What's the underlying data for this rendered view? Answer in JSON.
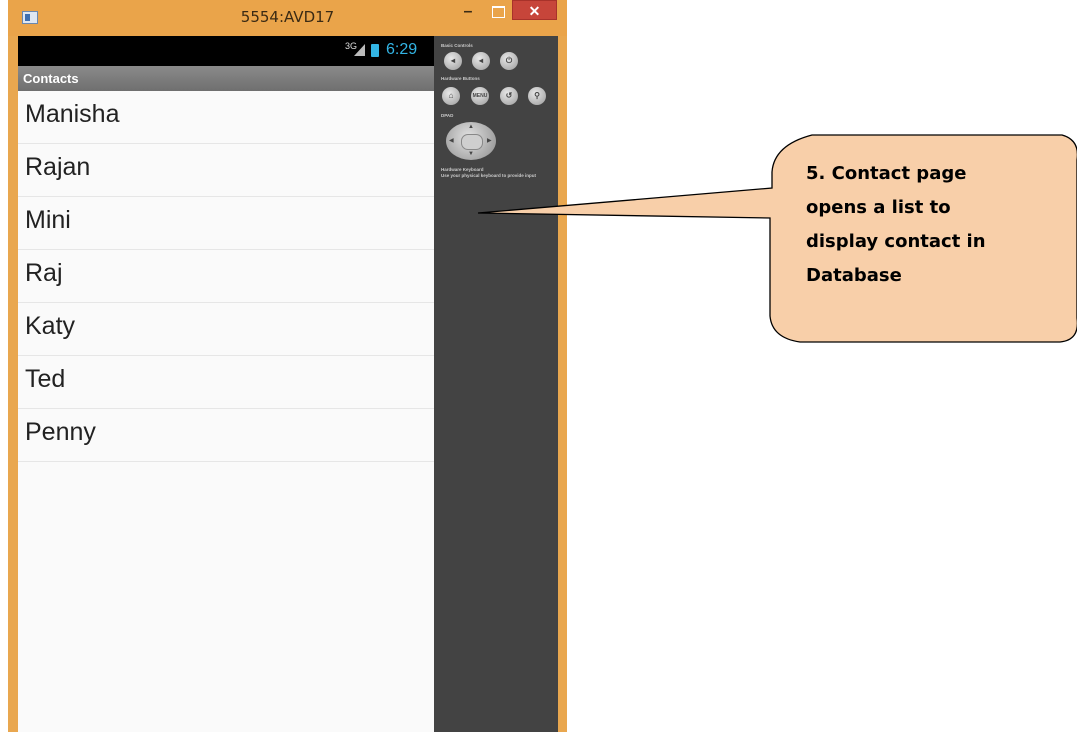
{
  "window": {
    "title": "5554:AVD17",
    "minimize_label": "–",
    "close_label": "✕"
  },
  "status_bar": {
    "network": "3G",
    "time": "6:29"
  },
  "action_bar": {
    "title": "Contacts"
  },
  "contacts": [
    "Manisha",
    "Rajan",
    "Mini",
    "Raj",
    "Katy",
    "Ted",
    "Penny"
  ],
  "controls": {
    "basic_controls_label": "Basic Controls",
    "hardware_buttons_label": "Hardware Buttons",
    "dpad_label": "DPAD",
    "keyboard_label": "Hardware Keyboard",
    "keyboard_hint": "Use your physical keyboard to provide input",
    "menu_label": "MENU"
  },
  "callout": {
    "lines": [
      "5. Contact page",
      "opens a list to",
      "display contact in",
      "Database"
    ]
  },
  "colors": {
    "window_frame": "#e9a74f",
    "accent": "#33b5e5",
    "callout_fill": "#f8cfa9"
  }
}
